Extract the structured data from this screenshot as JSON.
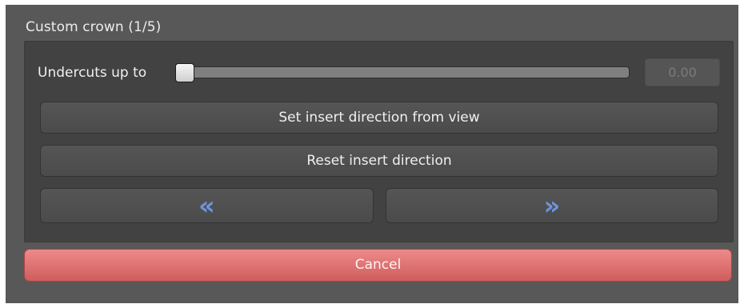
{
  "panel": {
    "title": "Custom crown (1/5)"
  },
  "undercut": {
    "label": "Undercuts up to",
    "slider_fraction": 0.0,
    "value": "0.00"
  },
  "buttons": {
    "set_insert": "Set insert direction from view",
    "reset_insert": "Reset insert direction",
    "prev_icon": "double-chevron-left-icon",
    "next_icon": "double-chevron-right-icon",
    "cancel": "Cancel"
  },
  "colors": {
    "panel_bg": "#585858",
    "group_bg": "#424242",
    "nav_icon": "#6d95dd",
    "cancel_bg": "#e07474"
  }
}
